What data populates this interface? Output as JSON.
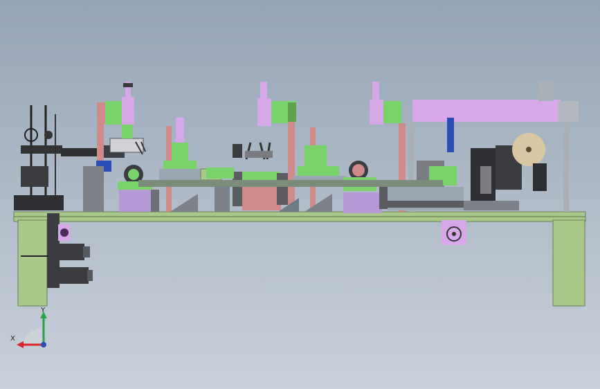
{
  "colors": {
    "background_top": "#95a4b6",
    "background_bottom": "#c9d1da",
    "frame_green": "#a9c98a",
    "pink": "#cf8a8a",
    "lavender": "#d6a8e8",
    "purple": "#b59ad6",
    "green_bright": "#79d36a",
    "dark_gray": "#55585e",
    "steel": "#7d8189",
    "tan": "#d9c6a3",
    "blue_accent": "#2b4db8",
    "axis_x": "#d7262b",
    "axis_y": "#27a447"
  },
  "axes": {
    "x_label": "X",
    "y_label": "Y"
  }
}
